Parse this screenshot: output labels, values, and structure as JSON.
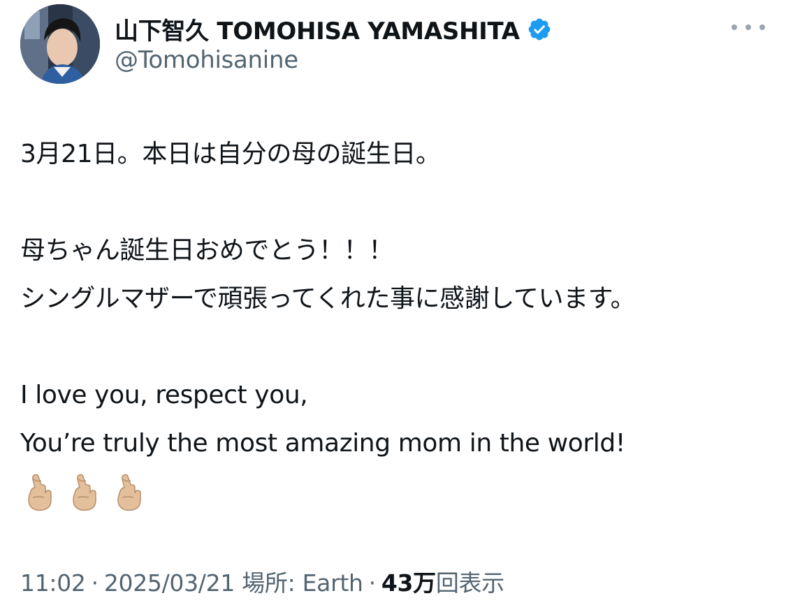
{
  "author": {
    "display_name": "山下智久 TOMOHISA YAMASHITA",
    "handle": "@Tomohisanine",
    "avatar": "profile-photo",
    "verified_icon": "verified-badge-icon",
    "verified_color": "#1d9bf0"
  },
  "menu_icon": "more-horizontal-icon",
  "tweet": {
    "lines": [
      "3月21日。本日は自分の母の誕生日。",
      "",
      "母ちゃん誕生日おめでとう！！！",
      "シングルマザーで頑張ってくれた事に感謝しています。",
      "",
      "I love you, respect you,",
      "You’re truly the most amazing mom in the world!"
    ],
    "emoji": [
      "🫰🏼",
      "🫰🏼",
      "🫰🏼"
    ],
    "emoji_icon": "finger-heart-hand-icon",
    "emoji_color": "#e3bf9b"
  },
  "meta": {
    "time": "11:02",
    "separator": "·",
    "date": "2025/03/21",
    "location_label": "場所: Earth",
    "views_count": "43万",
    "views_label": "回表示"
  }
}
